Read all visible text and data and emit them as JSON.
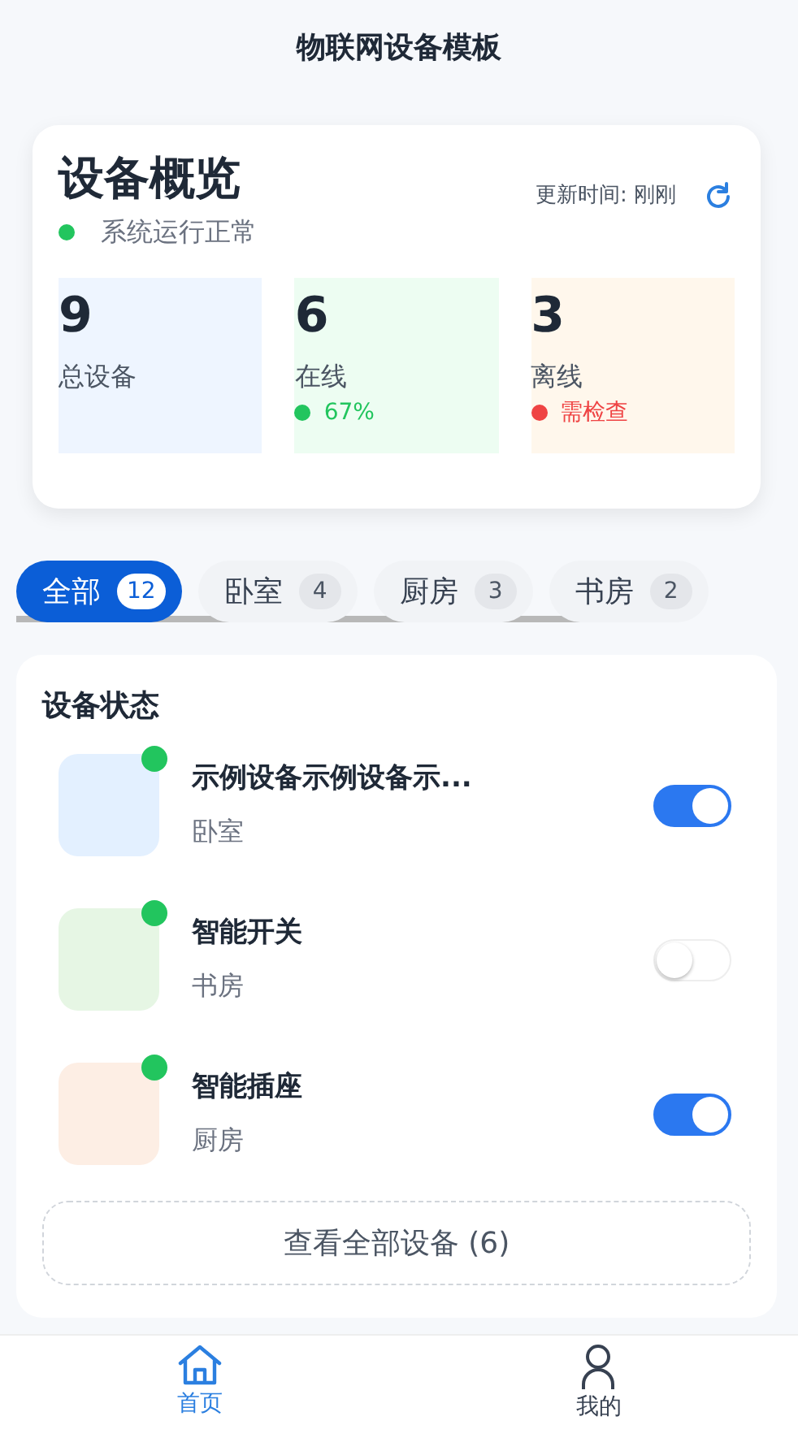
{
  "header": {
    "title": "物联网设备模板"
  },
  "overview": {
    "title": "设备概览",
    "status": {
      "text": "系统运行正常",
      "color": "#22c55e"
    },
    "updated": "更新时间: 刚刚",
    "stats": [
      {
        "value": "9",
        "label": "总设备",
        "color": "#eef5ff"
      },
      {
        "value": "6",
        "label": "在线",
        "color": "#edfdf2",
        "note": {
          "text": "67%",
          "color": "#22c55e"
        }
      },
      {
        "value": "3",
        "label": "离线",
        "color": "#fff7ec",
        "note": {
          "text": "需检查",
          "color": "#ef4444"
        }
      }
    ]
  },
  "categories": [
    {
      "label": "全部",
      "count": "12",
      "selected": true
    },
    {
      "label": "卧室",
      "count": "4",
      "selected": false
    },
    {
      "label": "厨房",
      "count": "3",
      "selected": false
    },
    {
      "label": "书房",
      "count": "2",
      "selected": false
    }
  ],
  "devices_panel": {
    "title": "设备状态",
    "more": "查看全部设备 (6)",
    "devices": [
      {
        "name": "示例设备示例设备示...",
        "room": "卧室",
        "color": "#e3f0ff",
        "online": true,
        "on": true
      },
      {
        "name": "智能开关",
        "room": "书房",
        "color": "#e6f6e4",
        "online": true,
        "on": false
      },
      {
        "name": "智能插座",
        "room": "厨房",
        "color": "#fdeee4",
        "online": true,
        "on": true
      }
    ]
  },
  "bottom_nav": [
    {
      "label": "首页",
      "kind": "home",
      "selected": true
    },
    {
      "label": "我的",
      "kind": "user",
      "selected": false
    }
  ]
}
